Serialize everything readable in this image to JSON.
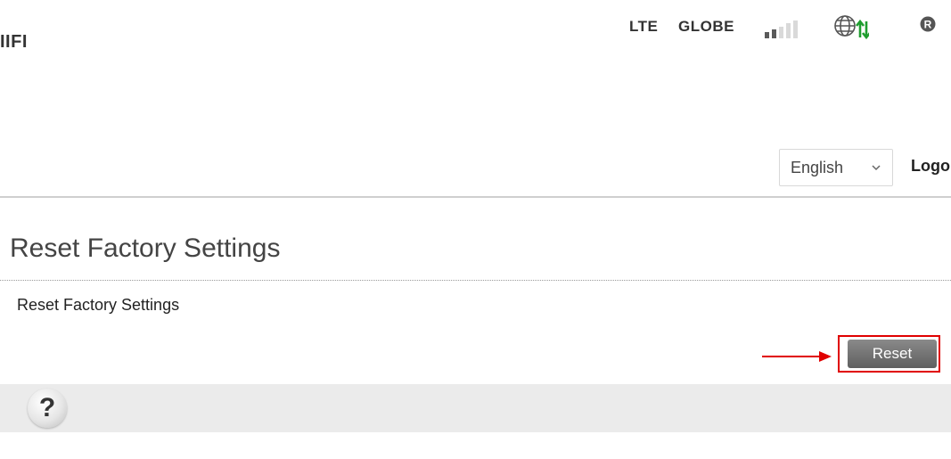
{
  "header": {
    "brand": "IIFI",
    "network_type": "LTE",
    "carrier": "GLOBE",
    "signal_bars_active": 2,
    "signal_bars_total": 5,
    "roaming_badge": "R",
    "language_selected": "English",
    "logout_label": "Logo"
  },
  "page": {
    "title": "Reset Factory Settings",
    "row_label": "Reset Factory Settings",
    "reset_button": "Reset"
  },
  "help": {
    "icon_text": "?"
  },
  "colors": {
    "signal_active": "#5a5a5a",
    "signal_inactive": "#d9d9d9",
    "data_arrows": "#1f9d2f",
    "highlight": "#e00000",
    "button": "#6e6e6e",
    "help_bar": "#ebebeb"
  }
}
